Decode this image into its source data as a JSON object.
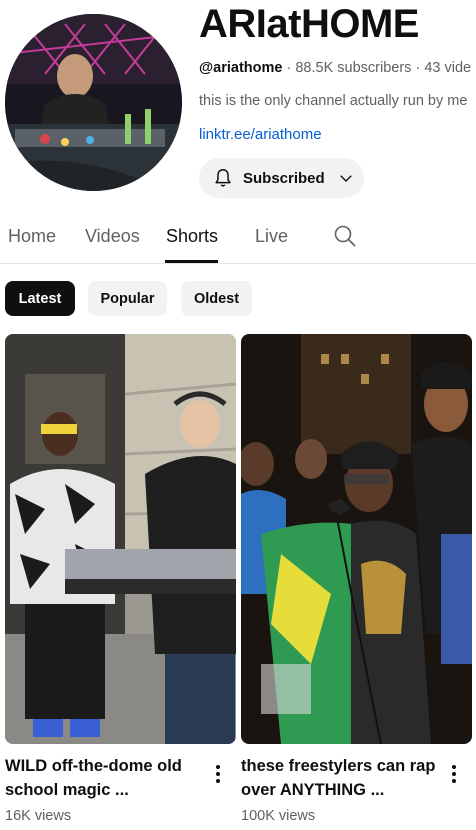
{
  "channel": {
    "name": "ARIatHOME",
    "handle": "@ariathome",
    "subscribers": "88.5K subscribers",
    "videos_count": "43 vide",
    "meta_separator": "·",
    "description": "this is the only channel actually run by me",
    "link": "linktr.ee/ariathome",
    "subscribe_label": "Subscribed"
  },
  "tabs": [
    {
      "label": "Home",
      "active": false
    },
    {
      "label": "Videos",
      "active": false
    },
    {
      "label": "Shorts",
      "active": true
    },
    {
      "label": "Live",
      "active": false
    }
  ],
  "filters": [
    {
      "label": "Latest",
      "active": true
    },
    {
      "label": "Popular",
      "active": false
    },
    {
      "label": "Oldest",
      "active": false
    }
  ],
  "shorts": [
    {
      "title": "WILD off-the-dome old school magic ...",
      "views": "16K views"
    },
    {
      "title": "these freestylers can rap over ANYTHING ...",
      "views": "100K views"
    }
  ],
  "icons": {
    "bell": "bell-icon",
    "chevron": "chevron-down-icon",
    "search": "search-icon",
    "more": "more-vert-icon"
  },
  "colors": {
    "link": "#065fd4",
    "chip_active_bg": "#0f0f0f",
    "chip_bg": "#f2f2f2",
    "secondary_text": "#606060"
  }
}
